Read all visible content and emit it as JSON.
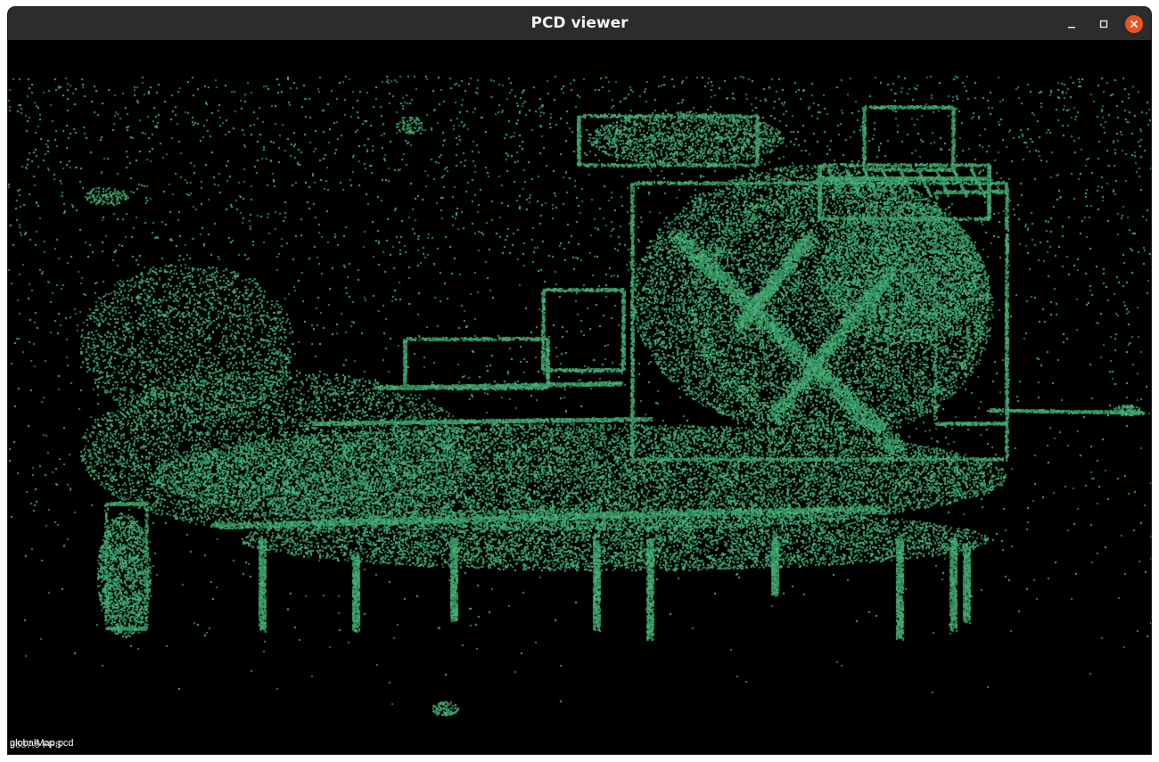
{
  "window": {
    "title": "PCD viewer"
  },
  "viewer": {
    "background": "#000000",
    "point_color": "#3a9a66",
    "file_label": "globalMap.pcd",
    "fps_label": "3637.5 FPS"
  },
  "icons": {
    "minimize": "minimize-icon",
    "maximize": "maximize-icon",
    "close": "close-icon"
  },
  "colors": {
    "titlebar": "#2c2c2c",
    "close_button": "#e95420"
  }
}
